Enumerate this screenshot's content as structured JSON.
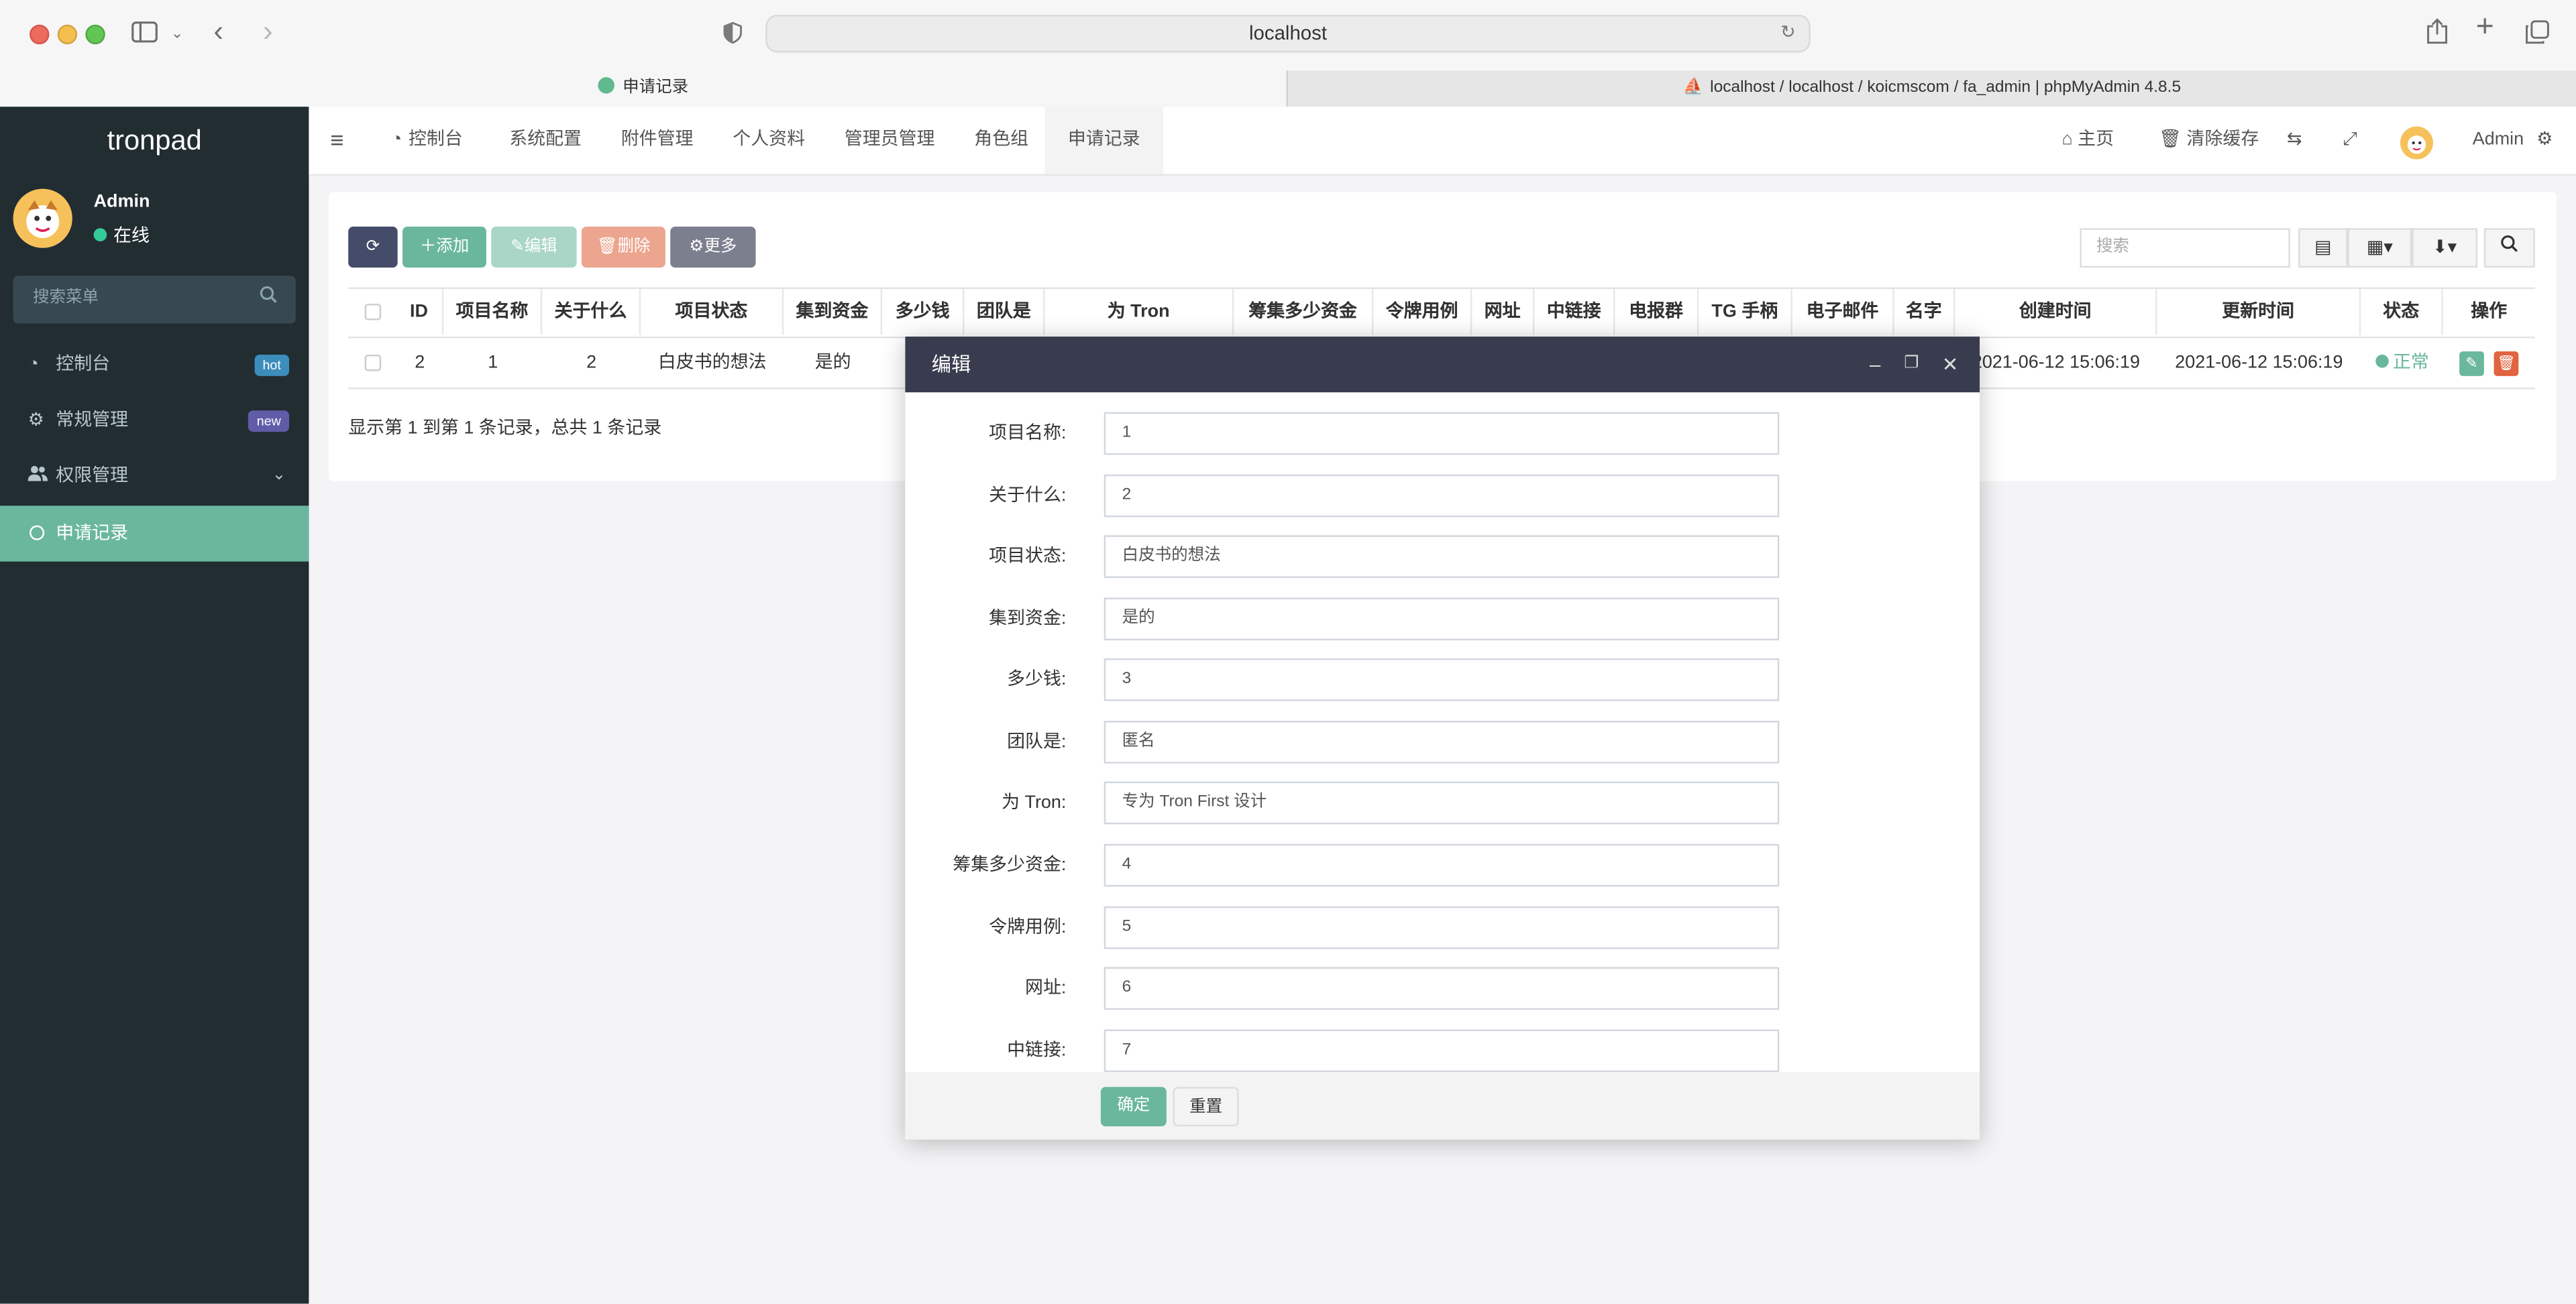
{
  "browser": {
    "url": "localhost",
    "tabs": [
      {
        "label": "申请记录"
      },
      {
        "label": "localhost / localhost / koicmscom / fa_admin | phpMyAdmin 4.8.5"
      }
    ]
  },
  "sidebar": {
    "brand": "tronpad",
    "user": {
      "name": "Admin",
      "status": "在线"
    },
    "search_placeholder": "搜索菜单",
    "items": [
      {
        "label": "控制台",
        "badge": "hot"
      },
      {
        "label": "常规管理",
        "badge": "new"
      },
      {
        "label": "权限管理"
      },
      {
        "label": "申请记录"
      }
    ]
  },
  "topnav": {
    "items": [
      "控制台",
      "系统配置",
      "附件管理",
      "个人资料",
      "管理员管理",
      "角色组",
      "申请记录"
    ],
    "home": "主页",
    "clear_cache": "清除缓存",
    "admin": "Admin"
  },
  "toolbar": {
    "add": "添加",
    "edit": "编辑",
    "delete": "删除",
    "more": "更多",
    "search_placeholder": "搜索"
  },
  "table": {
    "headers": [
      "ID",
      "项目名称",
      "关于什么",
      "项目状态",
      "集到资金",
      "多少钱",
      "团队是",
      "为 Tron",
      "筹集多少资金",
      "令牌用例",
      "网址",
      "中链接",
      "电报群",
      "TG 手柄",
      "电子邮件",
      "名字",
      "创建时间",
      "更新时间",
      "状态",
      "操作"
    ],
    "row": {
      "id": "2",
      "name": "1",
      "about": "2",
      "status_text": "白皮书的想法",
      "funded": "是的",
      "created": "2021-06-12 15:06:19",
      "updated": "2021-06-12 15:06:19",
      "state": "正常"
    },
    "footer": "显示第 1 到第 1 条记录，总共 1 条记录"
  },
  "modal": {
    "title": "编辑",
    "fields": [
      {
        "label": "项目名称:",
        "value": "1"
      },
      {
        "label": "关于什么:",
        "value": "2"
      },
      {
        "label": "项目状态:",
        "value": "白皮书的想法"
      },
      {
        "label": "集到资金:",
        "value": "是的"
      },
      {
        "label": "多少钱:",
        "value": "3"
      },
      {
        "label": "团队是:",
        "value": "匿名"
      },
      {
        "label": "为 Tron:",
        "value": "专为 Tron First 设计"
      },
      {
        "label": "筹集多少资金:",
        "value": "4"
      },
      {
        "label": "令牌用例:",
        "value": "5"
      },
      {
        "label": "网址:",
        "value": "6"
      },
      {
        "label": "中链接:",
        "value": "7"
      }
    ],
    "confirm": "确定",
    "reset": "重置"
  },
  "colors": {
    "sidebar_bg": "#222d32",
    "accent_green": "#6ab79d",
    "modal_header": "#383c4e"
  }
}
